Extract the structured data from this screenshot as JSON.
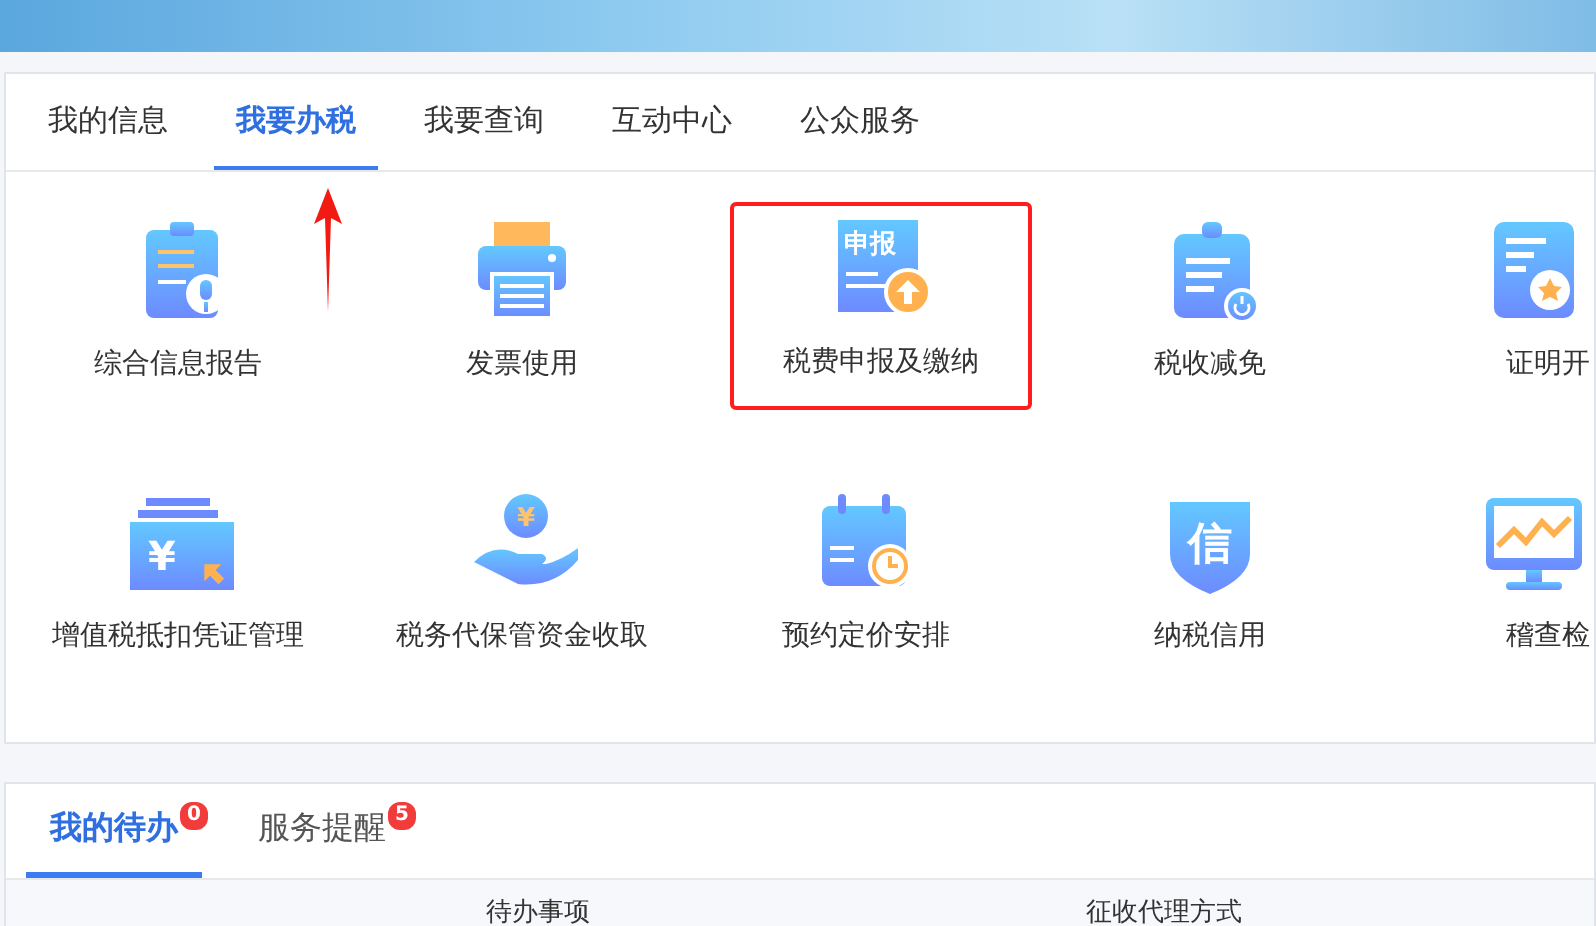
{
  "main_tabs": [
    {
      "label": "我的信息",
      "selected": false
    },
    {
      "label": "我要办税",
      "selected": true
    },
    {
      "label": "我要查询",
      "selected": false
    },
    {
      "label": "互动中心",
      "selected": false
    },
    {
      "label": "公众服务",
      "selected": false
    }
  ],
  "services": [
    {
      "label": "综合信息报告",
      "highlighted": false
    },
    {
      "label": "发票使用",
      "highlighted": false
    },
    {
      "label": "税费申报及缴纳",
      "glyph": "申报",
      "highlighted": true
    },
    {
      "label": "税收减免",
      "highlighted": false
    },
    {
      "label": "证明开",
      "highlighted": false
    },
    {
      "label": "增值税抵扣凭证管理",
      "glyph": "¥",
      "highlighted": false
    },
    {
      "label": "税务代保管资金收取",
      "glyph": "¥",
      "highlighted": false
    },
    {
      "label": "预约定价安排",
      "highlighted": false
    },
    {
      "label": "纳税信用",
      "glyph": "信",
      "highlighted": false
    },
    {
      "label": "稽查检",
      "highlighted": false
    }
  ],
  "annotations": [
    {
      "kind": "arrow-up"
    }
  ],
  "todo_tabs": [
    {
      "label": "我的待办",
      "badge": "0",
      "selected": true
    },
    {
      "label": "服务提醒",
      "badge": "5",
      "selected": false
    }
  ],
  "table": {
    "columns": [
      "待办事项",
      "征收代理方式"
    ]
  }
}
